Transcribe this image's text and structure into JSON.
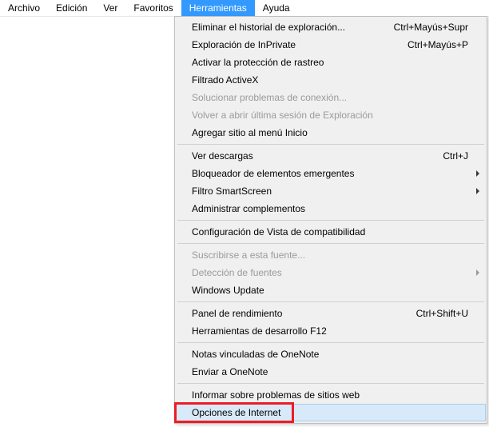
{
  "menubar": {
    "items": [
      {
        "label": "Archivo"
      },
      {
        "label": "Edición"
      },
      {
        "label": "Ver"
      },
      {
        "label": "Favoritos"
      },
      {
        "label": "Herramientas"
      },
      {
        "label": "Ayuda"
      }
    ],
    "active_index": 4
  },
  "dropdown": {
    "items": [
      {
        "label": "Eliminar el historial de exploración...",
        "shortcut": "Ctrl+Mayús+Supr"
      },
      {
        "label": "Exploración de InPrivate",
        "shortcut": "Ctrl+Mayús+P"
      },
      {
        "label": "Activar la protección de rastreo"
      },
      {
        "label": "Filtrado ActiveX"
      },
      {
        "label": "Solucionar problemas de conexión...",
        "disabled": true
      },
      {
        "label": "Volver a abrir última sesión de Exploración",
        "disabled": true
      },
      {
        "label": "Agregar sitio al menú Inicio"
      },
      {
        "separator": true
      },
      {
        "label": "Ver descargas",
        "shortcut": "Ctrl+J"
      },
      {
        "label": "Bloqueador de elementos emergentes",
        "submenu": true
      },
      {
        "label": "Filtro SmartScreen",
        "submenu": true
      },
      {
        "label": "Administrar complementos"
      },
      {
        "separator": true
      },
      {
        "label": "Configuración de Vista de compatibilidad"
      },
      {
        "separator": true
      },
      {
        "label": "Suscribirse a esta fuente...",
        "disabled": true
      },
      {
        "label": "Detección de fuentes",
        "submenu": true,
        "disabled": true
      },
      {
        "label": "Windows Update"
      },
      {
        "separator": true
      },
      {
        "label": "Panel de rendimiento",
        "shortcut": "Ctrl+Shift+U"
      },
      {
        "label": "Herramientas de desarrollo F12"
      },
      {
        "separator": true
      },
      {
        "label": "Notas vinculadas de OneNote"
      },
      {
        "label": "Enviar a OneNote"
      },
      {
        "separator": true
      },
      {
        "label": "Informar sobre problemas de sitios web"
      },
      {
        "label": "Opciones de Internet",
        "hover": true,
        "highlight": true
      }
    ]
  }
}
